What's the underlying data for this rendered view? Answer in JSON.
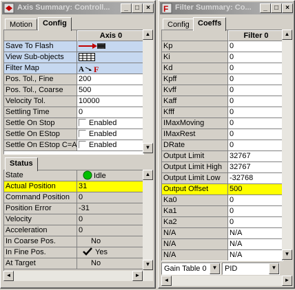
{
  "axis_window": {
    "title": "Axis Summary: Controll...",
    "tabs": [
      "Motion",
      "Config"
    ],
    "active_tab": "Config",
    "column_header": "Axis 0",
    "rows": [
      {
        "label": "Save To Flash",
        "value": ""
      },
      {
        "label": "View Sub-objects",
        "value": ""
      },
      {
        "label": "Filter Map",
        "value": ""
      },
      {
        "label": "Pos. Tol., Fine",
        "value": "200"
      },
      {
        "label": "Pos. Tol., Coarse",
        "value": "500"
      },
      {
        "label": "Velocity Tol.",
        "value": "10000"
      },
      {
        "label": "Settling Time",
        "value": "0"
      },
      {
        "label": "Settle On Stop",
        "value": "Enabled"
      },
      {
        "label": "Settle On EStop",
        "value": "Enabled"
      },
      {
        "label": "Settle On EStop C=A",
        "value": "Enabled"
      }
    ],
    "status_tab": "Status",
    "status_rows": [
      {
        "label": "State",
        "value": "Idle"
      },
      {
        "label": "Actual Position",
        "value": "31"
      },
      {
        "label": "Command Position",
        "value": "0"
      },
      {
        "label": "Position Error",
        "value": "-31"
      },
      {
        "label": "Velocity",
        "value": "0"
      },
      {
        "label": "Acceleration",
        "value": "0"
      },
      {
        "label": "In Coarse Pos.",
        "value": "No"
      },
      {
        "label": "In Fine Pos.",
        "value": "Yes"
      },
      {
        "label": "At Target",
        "value": "No"
      }
    ]
  },
  "filter_window": {
    "title": "Filter Summary: Co...",
    "tabs": [
      "Config",
      "Coeffs"
    ],
    "active_tab": "Coeffs",
    "column_header": "Filter 0",
    "rows": [
      {
        "label": "Kp",
        "value": "0"
      },
      {
        "label": "Ki",
        "value": "0"
      },
      {
        "label": "Kd",
        "value": "0"
      },
      {
        "label": "Kpff",
        "value": "0"
      },
      {
        "label": "Kvff",
        "value": "0"
      },
      {
        "label": "Kaff",
        "value": "0"
      },
      {
        "label": "Kfff",
        "value": "0"
      },
      {
        "label": "IMaxMoving",
        "value": "0"
      },
      {
        "label": "IMaxRest",
        "value": "0"
      },
      {
        "label": "DRate",
        "value": "0"
      },
      {
        "label": "Output Limit",
        "value": "32767"
      },
      {
        "label": "Output Limit High",
        "value": "32767"
      },
      {
        "label": "Output Limit Low",
        "value": "-32768"
      },
      {
        "label": "Output Offset",
        "value": "500"
      },
      {
        "label": "Ka0",
        "value": "0"
      },
      {
        "label": "Ka1",
        "value": "0"
      },
      {
        "label": "Ka2",
        "value": "0"
      },
      {
        "label": "N/A",
        "value": "N/A"
      },
      {
        "label": "N/A",
        "value": "N/A"
      },
      {
        "label": "N/A",
        "value": "N/A"
      }
    ],
    "gain_table_select": "Gain Table 0",
    "filter_type_select": "PID"
  },
  "colors": {
    "highlight_blue": "#c6d8f0",
    "highlight_yellow": "#ffff00",
    "idle_led": "#00c000"
  }
}
